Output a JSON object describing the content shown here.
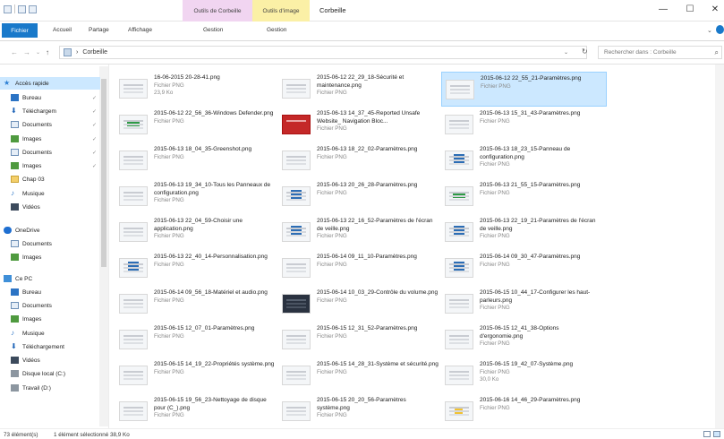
{
  "window": {
    "title": "Corbeille",
    "context_tabs": [
      "Outils de Corbeille",
      "Outils d'image"
    ],
    "controls": {
      "minimize": "—",
      "maximize": "☐",
      "close": "✕"
    }
  },
  "ribbon": {
    "tabs": [
      "Fichier",
      "Accueil",
      "Partage",
      "Affichage",
      "Gestion",
      "Gestion"
    ]
  },
  "address": {
    "path": "Corbeille",
    "separator": "›",
    "search_placeholder": "Rechercher dans : Corbeille"
  },
  "nav": [
    {
      "label": "Accès rapide",
      "icon": "quick-access-star-icon"
    },
    {
      "label": "Bureau",
      "icon": "desktop-icon",
      "pinned": true
    },
    {
      "label": "Téléchargem",
      "icon": "download-icon",
      "pinned": true
    },
    {
      "label": "Documents",
      "icon": "documents-icon",
      "pinned": true
    },
    {
      "label": "Images",
      "icon": "images-icon",
      "pinned": true
    },
    {
      "label": "Documents",
      "icon": "documents-icon",
      "pinned": true
    },
    {
      "label": "Images",
      "icon": "images-icon",
      "pinned": true
    },
    {
      "label": "Chap 03",
      "icon": "folder-icon"
    },
    {
      "label": "Musique",
      "icon": "music-icon"
    },
    {
      "label": "Vidéos",
      "icon": "videos-icon"
    },
    {
      "label": "OneDrive",
      "icon": "onedrive-icon"
    },
    {
      "label": "Documents",
      "icon": "documents-icon"
    },
    {
      "label": "Images",
      "icon": "images-icon"
    },
    {
      "label": "Ce PC",
      "icon": "pc-icon"
    },
    {
      "label": "Bureau",
      "icon": "desktop-icon"
    },
    {
      "label": "Documents",
      "icon": "documents-icon"
    },
    {
      "label": "Images",
      "icon": "images-icon"
    },
    {
      "label": "Musique",
      "icon": "music-icon"
    },
    {
      "label": "Téléchargement",
      "icon": "download-icon"
    },
    {
      "label": "Vidéos",
      "icon": "videos-icon"
    },
    {
      "label": "Disque local (C:)",
      "icon": "disk-icon"
    },
    {
      "label": "Travail (D:)",
      "icon": "disk-icon"
    }
  ],
  "files": [
    {
      "name": "16-06-2015 20-28-41.png",
      "type": "Fichier PNG",
      "size": "23,9 Ko",
      "thumb": "light"
    },
    {
      "name": "2015-06-12 22_29_18-Sécurité et maintenance.png",
      "type": "Fichier PNG",
      "thumb": "light"
    },
    {
      "name": "2015-06-12 22_55_21-Paramètres.png",
      "type": "Fichier PNG",
      "thumb": "light",
      "selected": true
    },
    {
      "name": "2015-06-12 22_56_36-Windows Defender.png",
      "type": "Fichier PNG",
      "thumb": "green"
    },
    {
      "name": "2015-06-13 14_37_45-Reported Unsafe Website_ Navigation Bloc...",
      "type": "Fichier PNG",
      "thumb": "red"
    },
    {
      "name": "2015-06-13 15_31_43-Paramètres.png",
      "type": "Fichier PNG",
      "thumb": "light"
    },
    {
      "name": "2015-06-13 18_04_35-Greenshot.png",
      "type": "Fichier PNG",
      "thumb": "light"
    },
    {
      "name": "2015-06-13 18_22_02-Paramètres.png",
      "type": "Fichier PNG",
      "thumb": "light"
    },
    {
      "name": "2015-06-13 18_23_15-Panneau de configuration.png",
      "type": "Fichier PNG",
      "thumb": "blue"
    },
    {
      "name": "2015-06-13 19_34_10-Tous les Panneaux de configuration.png",
      "type": "Fichier PNG",
      "thumb": "light"
    },
    {
      "name": "2015-06-13 20_26_28-Paramètres.png",
      "type": "Fichier PNG",
      "thumb": "blue"
    },
    {
      "name": "2015-06-13 21_55_15-Paramètres.png",
      "type": "Fichier PNG",
      "thumb": "green"
    },
    {
      "name": "2015-06-13 22_04_59-Choisir une application.png",
      "type": "Fichier PNG",
      "thumb": "light"
    },
    {
      "name": "2015-06-13 22_16_52-Paramètres de l'écran de veille.png",
      "type": "Fichier PNG",
      "thumb": "blue"
    },
    {
      "name": "2015-06-13 22_19_21-Paramètres de l'écran de veille.png",
      "type": "Fichier PNG",
      "thumb": "blue"
    },
    {
      "name": "2015-06-13 22_40_14-Personnalisation.png",
      "type": "Fichier PNG",
      "thumb": "blue"
    },
    {
      "name": "2015-06-14 09_11_10-Paramètres.png",
      "type": "Fichier PNG",
      "thumb": "light"
    },
    {
      "name": "2015-06-14 09_30_47-Paramètres.png",
      "type": "Fichier PNG",
      "thumb": "blue"
    },
    {
      "name": "2015-06-14 09_56_18-Matériel et audio.png",
      "type": "Fichier PNG",
      "thumb": "light"
    },
    {
      "name": "2015-06-14 10_03_29-Contrôle du volume.png",
      "type": "Fichier PNG",
      "thumb": "dark"
    },
    {
      "name": "2015-06-15 10_44_17-Configurer les haut-parleurs.png",
      "type": "Fichier PNG",
      "thumb": "light"
    },
    {
      "name": "2015-06-15 12_07_01-Paramètres.png",
      "type": "Fichier PNG",
      "thumb": "light"
    },
    {
      "name": "2015-06-15 12_31_52-Paramètres.png",
      "type": "Fichier PNG",
      "thumb": "light"
    },
    {
      "name": "2015-06-15 12_41_38-Options d'ergonomie.png",
      "type": "Fichier PNG",
      "thumb": "light"
    },
    {
      "name": "2015-06-15 14_19_22-Propriétés système.png",
      "type": "Fichier PNG",
      "thumb": "light"
    },
    {
      "name": "2015-06-15 14_28_31-Système et sécurité.png",
      "type": "Fichier PNG",
      "thumb": "light"
    },
    {
      "name": "2015-06-15 19_42_07-Système.png",
      "type": "Fichier PNG",
      "size": "30,0 Ko",
      "thumb": "light"
    },
    {
      "name": "2015-06-15 19_56_23-Nettoyage de disque pour (C_).png",
      "type": "Fichier PNG",
      "thumb": "light"
    },
    {
      "name": "2015-06-15 20_20_56-Paramètres système.png",
      "type": "Fichier PNG",
      "thumb": "light"
    },
    {
      "name": "2015-06-16 14_46_29-Paramètres.png",
      "type": "Fichier PNG",
      "thumb": "yellow"
    }
  ],
  "status": {
    "count": "73 élément(s)",
    "selection": "1 élément sélectionné 38,9 Ko"
  }
}
